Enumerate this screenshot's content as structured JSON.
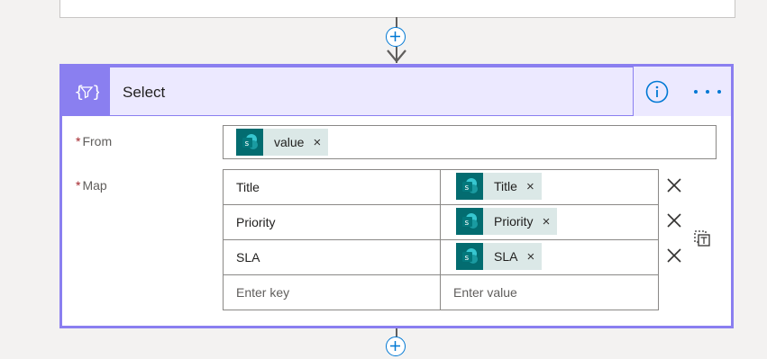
{
  "header": {
    "title": "Select"
  },
  "from": {
    "label": "From",
    "required_marker": "*",
    "token": {
      "label": "value",
      "icon": "sharepoint-icon"
    }
  },
  "map": {
    "label": "Map",
    "required_marker": "*",
    "rows": [
      {
        "key": "Title",
        "value_token": "Title",
        "icon": "sharepoint-icon"
      },
      {
        "key": "Priority",
        "value_token": "Priority",
        "icon": "sharepoint-icon"
      },
      {
        "key": "SLA",
        "value_token": "SLA",
        "icon": "sharepoint-icon"
      }
    ],
    "empty_row": {
      "key_placeholder": "Enter key",
      "value_placeholder": "Enter value"
    }
  },
  "token_remove_glyph": "×",
  "colors": {
    "accent": "#8a7ff0",
    "header_bg": "#ece9ff",
    "sharepoint": "#036c70",
    "token_bg": "#dbe8e7",
    "link_blue": "#0078d4"
  }
}
